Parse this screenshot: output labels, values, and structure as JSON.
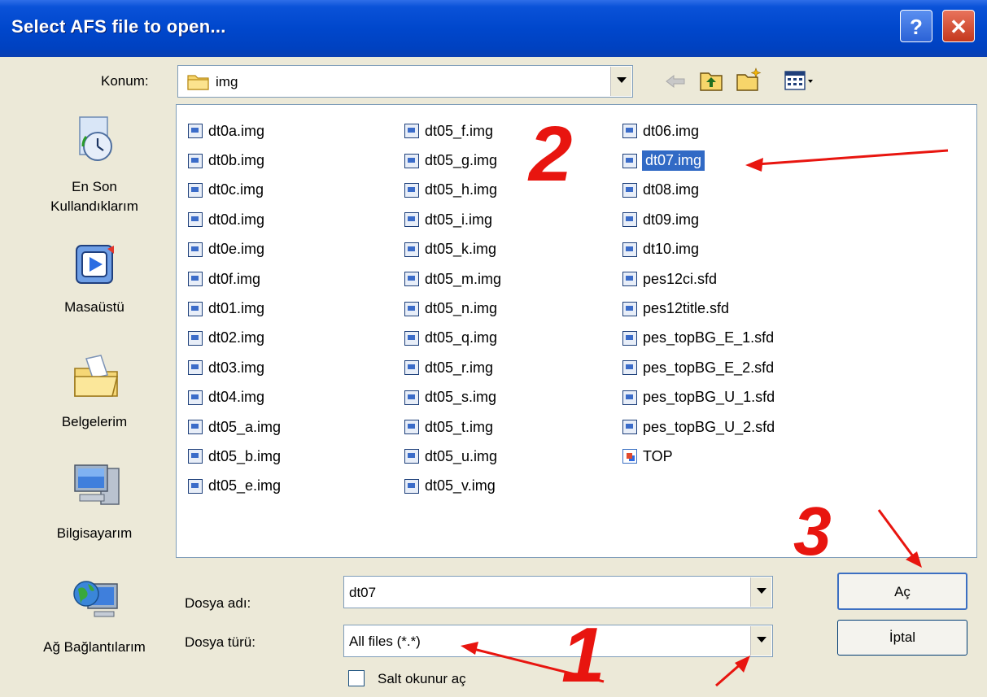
{
  "window": {
    "title": "Select AFS file to open...",
    "help_glyph": "?",
    "close_glyph": "✕"
  },
  "location": {
    "label": "Konum:",
    "value": "img"
  },
  "places": [
    {
      "label_line1": "En Son",
      "label_line2": "Kullandıklarım",
      "icon": "recent-documents-icon"
    },
    {
      "label_line1": "Masaüstü",
      "label_line2": "",
      "icon": "desktop-icon"
    },
    {
      "label_line1": "Belgelerim",
      "label_line2": "",
      "icon": "my-documents-icon"
    },
    {
      "label_line1": "Bilgisayarım",
      "label_line2": "",
      "icon": "my-computer-icon"
    },
    {
      "label_line1": "Ağ Bağlantılarım",
      "label_line2": "",
      "icon": "network-places-icon"
    }
  ],
  "files": {
    "col1": [
      "dt0a.img",
      "dt0b.img",
      "dt0c.img",
      "dt0d.img",
      "dt0e.img",
      "dt0f.img",
      "dt01.img",
      "dt02.img",
      "dt03.img",
      "dt04.img",
      "dt05_a.img",
      "dt05_b.img",
      "dt05_e.img"
    ],
    "col2": [
      "dt05_f.img",
      "dt05_g.img",
      "dt05_h.img",
      "dt05_i.img",
      "dt05_k.img",
      "dt05_m.img",
      "dt05_n.img",
      "dt05_q.img",
      "dt05_r.img",
      "dt05_s.img",
      "dt05_t.img",
      "dt05_u.img",
      "dt05_v.img"
    ],
    "col3": [
      "dt06.img",
      "dt07.img",
      "dt08.img",
      "dt09.img",
      "dt10.img",
      "pes12ci.sfd",
      "pes12title.sfd",
      "pes_topBG_E_1.sfd",
      "pes_topBG_E_2.sfd",
      "pes_topBG_U_1.sfd",
      "pes_topBG_U_2.sfd",
      "TOP"
    ],
    "selected": "dt07.img"
  },
  "filename": {
    "label": "Dosya adı:",
    "value": "dt07"
  },
  "filetype": {
    "label": "Dosya türü:",
    "value": "All files (*.*)"
  },
  "readonly": {
    "label": "Salt okunur aç"
  },
  "buttons": {
    "open": "Aç",
    "cancel": "İptal"
  },
  "annotations": {
    "one": "1",
    "two": "2",
    "three": "3",
    "color": "#e8150f"
  }
}
